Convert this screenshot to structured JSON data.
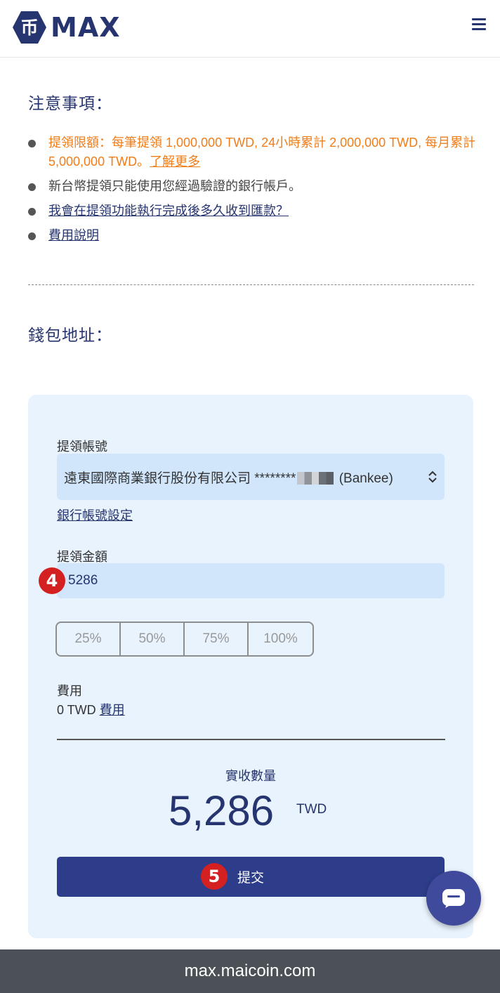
{
  "header": {
    "brand": "MAX",
    "logo_glyph": "币",
    "menu_icon": "hamburger-icon"
  },
  "notes": {
    "title": "注意事項：",
    "limit_text": "提領限額：每筆提領 1,000,000 TWD, 24小時累計 2,000,000 TWD, 每月累計 5,000,000 TWD。",
    "limit_link": "了解更多",
    "verified_account": "新台幣提領只能使用您經過驗證的銀行帳戶。",
    "timing_link": "我會在提領功能執行完成後多久收到匯款？",
    "fee_link": "費用說明"
  },
  "wallet": {
    "title": "錢包地址："
  },
  "form": {
    "account_label": "提領帳號",
    "account_prefix": "遠東國際商業銀行股份有限公司 ********",
    "account_suffix": "(Bankee)",
    "bank_settings_link": "銀行帳號設定",
    "amount_label": "提領金額",
    "amount_value": "5286",
    "percent_options": [
      "25%",
      "50%",
      "75%",
      "100%"
    ],
    "fee_label": "費用",
    "fee_value": "0 TWD",
    "fee_link": "費用",
    "received_label": "實收數量",
    "received_amount": "5,286",
    "received_unit": "TWD",
    "submit_label": "提交"
  },
  "badges": {
    "amount_step": "4",
    "submit_step": "5"
  },
  "colors": {
    "brand_navy": "#26346f",
    "warning_orange": "#ef7d1a",
    "card_bg": "#e8f3fd",
    "submit_bg": "#2e3d8a",
    "badge_red": "#d42020"
  },
  "browser": {
    "url": "max.maicoin.com"
  }
}
